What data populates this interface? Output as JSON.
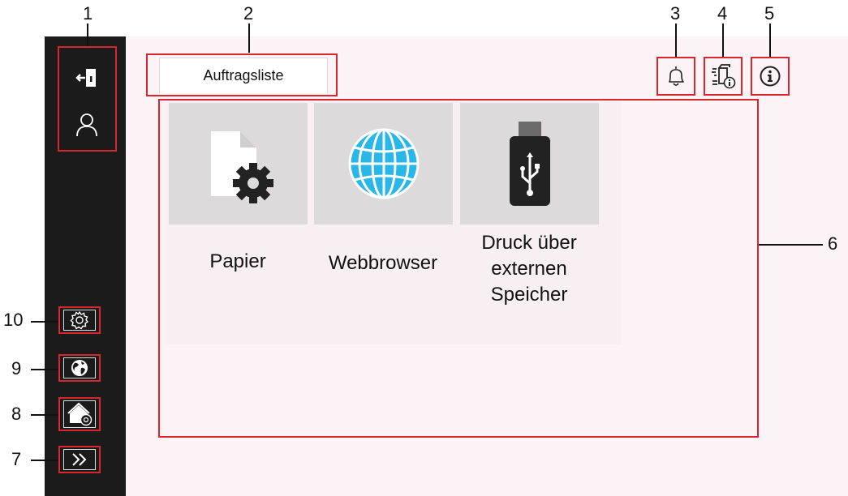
{
  "callouts": [
    "1",
    "2",
    "3",
    "4",
    "5",
    "6",
    "7",
    "8",
    "9",
    "10"
  ],
  "tab": {
    "label": "Auftragsliste"
  },
  "tiles": [
    {
      "label": "Papier",
      "icon": "paper-settings-icon"
    },
    {
      "label": "Webbrowser",
      "icon": "globe-icon"
    },
    {
      "label": "Druck über\nexternen\nSpeicher",
      "icon": "usb-drive-icon"
    }
  ],
  "sidebar": {
    "top_icons": [
      "logout-icon",
      "user-icon"
    ],
    "bottom_icons": [
      "settings-icon",
      "language-globe-icon",
      "home-settings-icon",
      "expand-chevron-icon"
    ]
  },
  "header_icons": [
    "bell-icon",
    "device-info-icon",
    "info-icon"
  ],
  "colors": {
    "callout_box": "#d8262e",
    "sidebar_bg": "#1b1b1b",
    "main_bg": "#fbf3f5",
    "tile_bg": "#dcdada",
    "globe": "#29b6e8"
  }
}
